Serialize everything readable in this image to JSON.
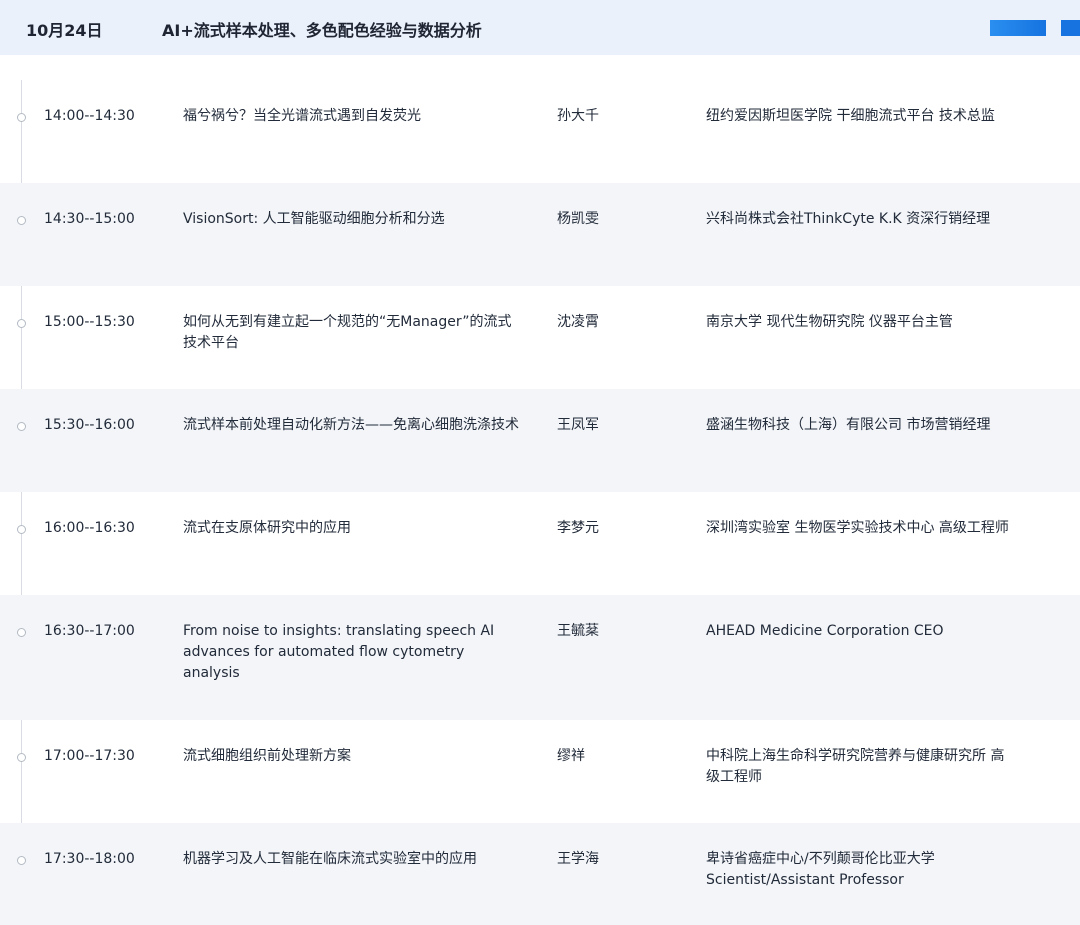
{
  "header": {
    "date": "10月24日",
    "title": "AI+流式样本处理、多色配色经验与数据分析"
  },
  "sessions": [
    {
      "time": "14:00--14:30",
      "topic": "福兮祸兮？当全光谱流式遇到自发荧光",
      "speaker": "孙大千",
      "org": "纽约爱因斯坦医学院 干细胞流式平台 技术总监"
    },
    {
      "time": "14:30--15:00",
      "topic": "VisionSort: 人工智能驱动细胞分析和分选",
      "speaker": "杨凯雯",
      "org": "兴科尚株式会社ThinkCyte K.K 资深行销经理"
    },
    {
      "time": "15:00--15:30",
      "topic": "如何从无到有建立起一个规范的“无Manager”的流式技术平台",
      "speaker": "沈凌霄",
      "org": "南京大学 现代生物研究院 仪器平台主管"
    },
    {
      "time": "15:30--16:00",
      "topic": "流式样本前处理自动化新方法——免离心细胞洗涤技术",
      "speaker": "王凤军",
      "org": "盛涵生物科技（上海）有限公司 市场营销经理"
    },
    {
      "time": "16:00--16:30",
      "topic": "流式在支原体研究中的应用",
      "speaker": "李梦元",
      "org": "深圳湾实验室 生物医学实验技术中心 高级工程师"
    },
    {
      "time": "16:30--17:00",
      "topic": "From noise to insights: translating speech AI advances for automated flow cytometry analysis",
      "speaker": "王毓棻",
      "org": "AHEAD Medicine Corporation CEO"
    },
    {
      "time": "17:00--17:30",
      "topic": "流式细胞组织前处理新方案",
      "speaker": "缪祥",
      "org": "中科院上海生命科学研究院营养与健康研究所 高级工程师"
    },
    {
      "time": "17:30--18:00",
      "topic": "机器学习及人工智能在临床流式实验室中的应用",
      "speaker": "王学海",
      "org": "卑诗省癌症中心/不列颠哥伦比亚大学 Scientist/Assistant Professor"
    }
  ]
}
